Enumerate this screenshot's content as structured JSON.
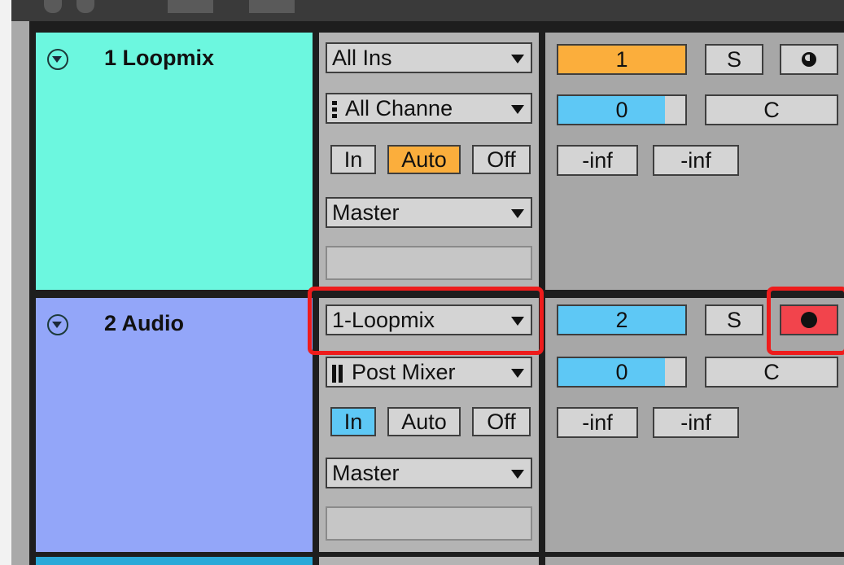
{
  "tracks": [
    {
      "name": "1 Loopmix",
      "color": "#6cf7df",
      "input_type": "All Ins",
      "input_channel": "All Channe",
      "monitor": {
        "in": "In",
        "auto": "Auto",
        "off": "Off",
        "active": "Auto"
      },
      "output": "Master",
      "track_number": "1",
      "solo": "S",
      "arm_state": "off",
      "volume": "0",
      "pan": "C",
      "meter_left": "-inf",
      "meter_right": "-inf"
    },
    {
      "name": "2 Audio",
      "color": "#93a6f9",
      "input_type": "1-Loopmix",
      "input_channel": "Post Mixer",
      "monitor": {
        "in": "In",
        "auto": "Auto",
        "off": "Off",
        "active": "In"
      },
      "output": "Master",
      "track_number": "2",
      "solo": "S",
      "arm_state": "armed",
      "volume": "0",
      "pan": "C",
      "meter_left": "-inf",
      "meter_right": "-inf"
    }
  ],
  "colors": {
    "highlight": "#ee1c1c",
    "arm_active": "#f2444c",
    "orange_active": "#fbae3c",
    "blue_active": "#5ec8f5"
  },
  "icons": {
    "fold": "chevron-down-circle-icon",
    "arm_off": "record-off-icon",
    "arm_on": "record-dot-icon"
  }
}
